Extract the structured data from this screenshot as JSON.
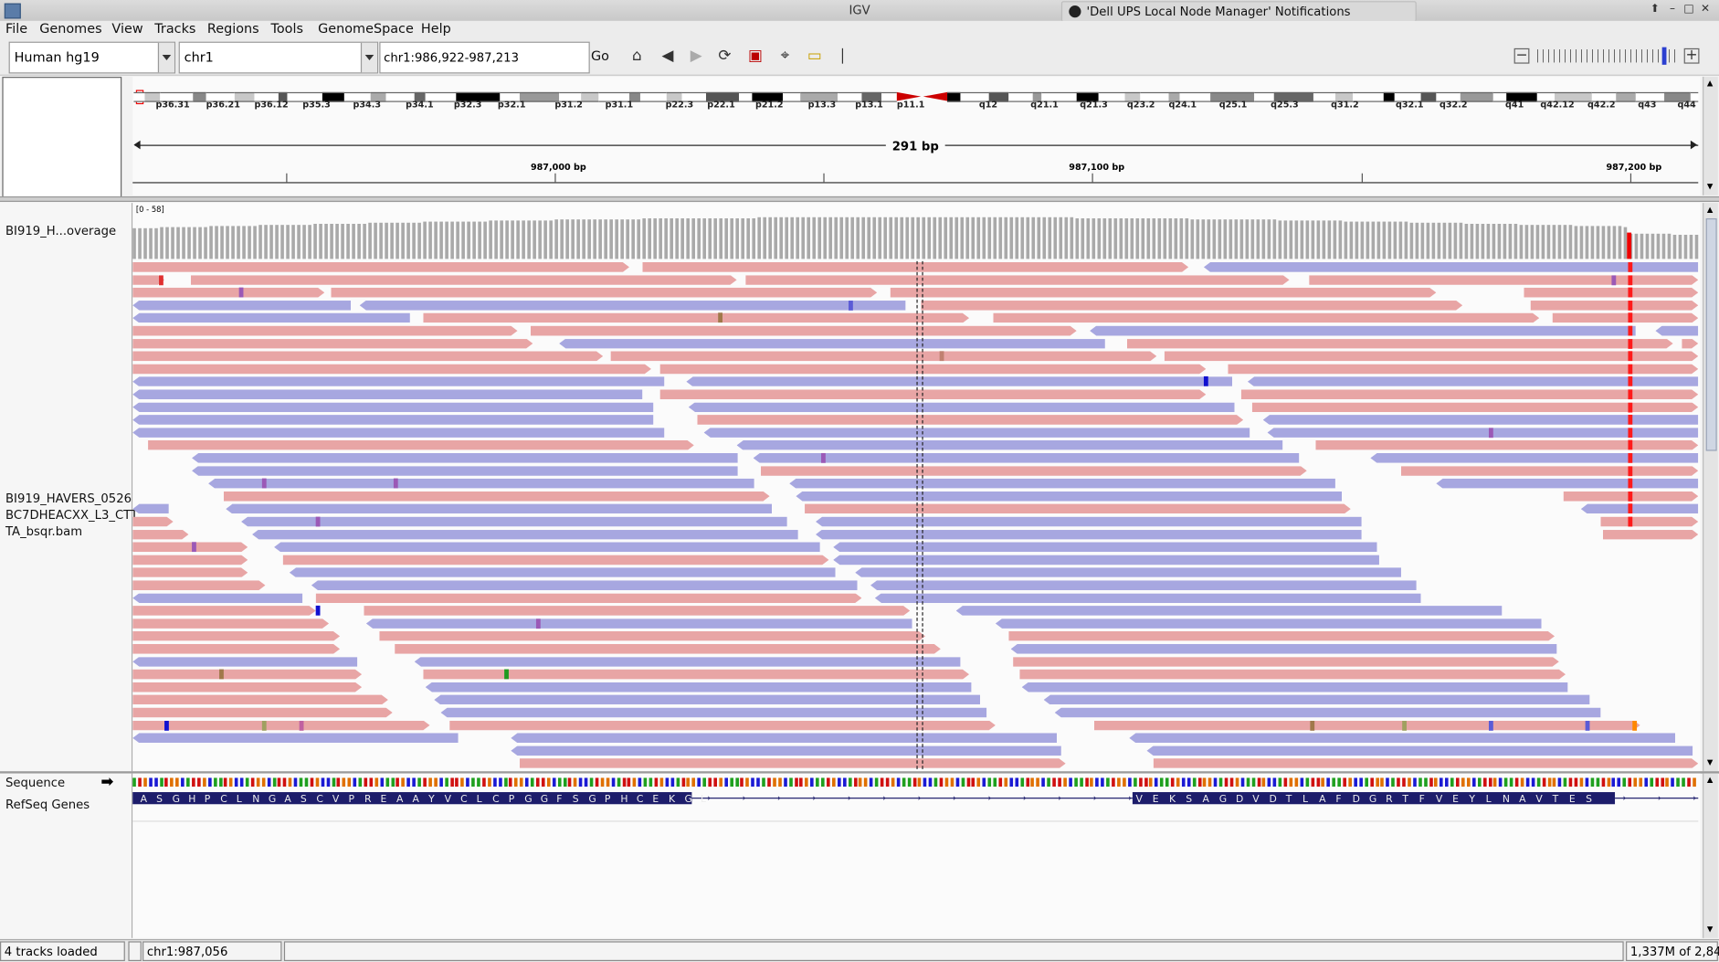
{
  "window": {
    "title": "IGV",
    "notification": "'Dell UPS Local Node Manager' Notifications"
  },
  "menu": [
    "File",
    "Genomes",
    "View",
    "Tracks",
    "Regions",
    "Tools",
    "GenomeSpace",
    "Help"
  ],
  "toolbar": {
    "genome": "Human hg19",
    "chromosome": "chr1",
    "locus": "chr1:986,922-987,213",
    "go_label": "Go"
  },
  "ruler": {
    "span_label": "291 bp",
    "ticks": [
      "987,000 bp",
      "987,100 bp",
      "987,200 bp"
    ],
    "bands": [
      "p36.31",
      "p36.21",
      "p36.12",
      "p35.3",
      "p34.3",
      "p34.1",
      "p32.3",
      "p32.1",
      "p31.2",
      "p31.1",
      "p22.3",
      "p22.1",
      "p21.2",
      "p13.3",
      "p13.1",
      "p11.1",
      "q12",
      "q21.1",
      "q21.3",
      "q23.2",
      "q24.1",
      "q25.1",
      "q25.3",
      "q31.2",
      "q32.1",
      "q32.2",
      "q41",
      "q42.12",
      "q42.2",
      "q43",
      "q44"
    ]
  },
  "tracks": {
    "coverage_name": "BI919_H...overage",
    "coverage_range": "[0 - 58]",
    "alignment_name_1": "BI919_HAVERS_0526",
    "alignment_name_2": "BC7DHEACXX_L3_CTT",
    "alignment_name_3": "TA_bsqr.bam",
    "sequence_name": "Sequence",
    "genes_name": "RefSeq Genes"
  },
  "amino_acids": "ASGHPCLNGASCVPREAAYVCLCPGGFSGPHCEKGLVEKSAGDVDTLAFDGRTFVEYLNAVTES",
  "status": {
    "tracks_loaded": "4 tracks loaded",
    "position": "chr1:987,056",
    "memory": "1,337M of 2,84..."
  },
  "colors": {
    "forward_read": "#e8a5a5",
    "reverse_read": "#a7a7e0",
    "mismatch": "#ff1a1a",
    "coverage": "#a9a9a9"
  }
}
